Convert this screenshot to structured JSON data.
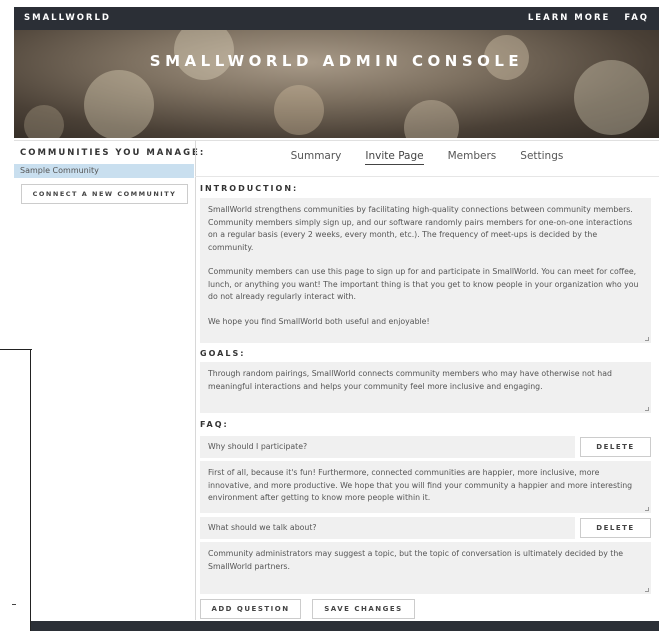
{
  "nav": {
    "brand": "SMALLWORLD",
    "links": [
      "LEARN MORE",
      "FAQ"
    ]
  },
  "hero": {
    "title": "SMALLWORLD ADMIN CONSOLE"
  },
  "sidebar": {
    "heading": "COMMUNITIES YOU MANAGE:",
    "communities": [
      "Sample Community"
    ],
    "connect_label": "CONNECT A NEW COMMUNITY"
  },
  "tabs": [
    {
      "label": "Summary",
      "active": false
    },
    {
      "label": "Invite Page",
      "active": true
    },
    {
      "label": "Members",
      "active": false
    },
    {
      "label": "Settings",
      "active": false
    }
  ],
  "introduction": {
    "label": "INTRODUCTION:",
    "paragraphs": [
      "SmallWorld strengthens communities by facilitating high-quality connections between community members. Community members simply sign up, and our software randomly pairs members for one-on-one interactions on a regular basis (every 2 weeks, every month, etc.). The frequency of meet-ups is decided by the community.",
      "Community members can use this page to sign up for and participate in SmallWorld. You can meet for coffee, lunch, or anything you want! The important thing is that you get to know people in your organization who you do not already regularly interact with.",
      "We hope you find SmallWorld both useful and enjoyable!"
    ]
  },
  "goals": {
    "label": "GOALS:",
    "text": "Through random pairings, SmallWorld connects community members who may have otherwise not had meaningful interactions and helps your community feel more inclusive and engaging."
  },
  "faq": {
    "label": "FAQ:",
    "delete_label": "DELETE",
    "items": [
      {
        "question": "Why should I participate?",
        "answer": "First of all, because it's fun! Furthermore, connected communities are happier, more inclusive, more innovative, and more productive. We hope that you will find your community a happier and more interesting environment after getting to know more people within it."
      },
      {
        "question": "What should we talk about?",
        "answer": "Community administrators may suggest a topic, but the topic of conversation is ultimately decided by the SmallWorld partners."
      }
    ]
  },
  "actions": {
    "add_question": "ADD QUESTION",
    "save_changes": "SAVE CHANGES"
  },
  "colors": {
    "navbar": "#2b2f36",
    "selected_community": "#c9dfef",
    "field_bg": "#f0f0f0"
  }
}
